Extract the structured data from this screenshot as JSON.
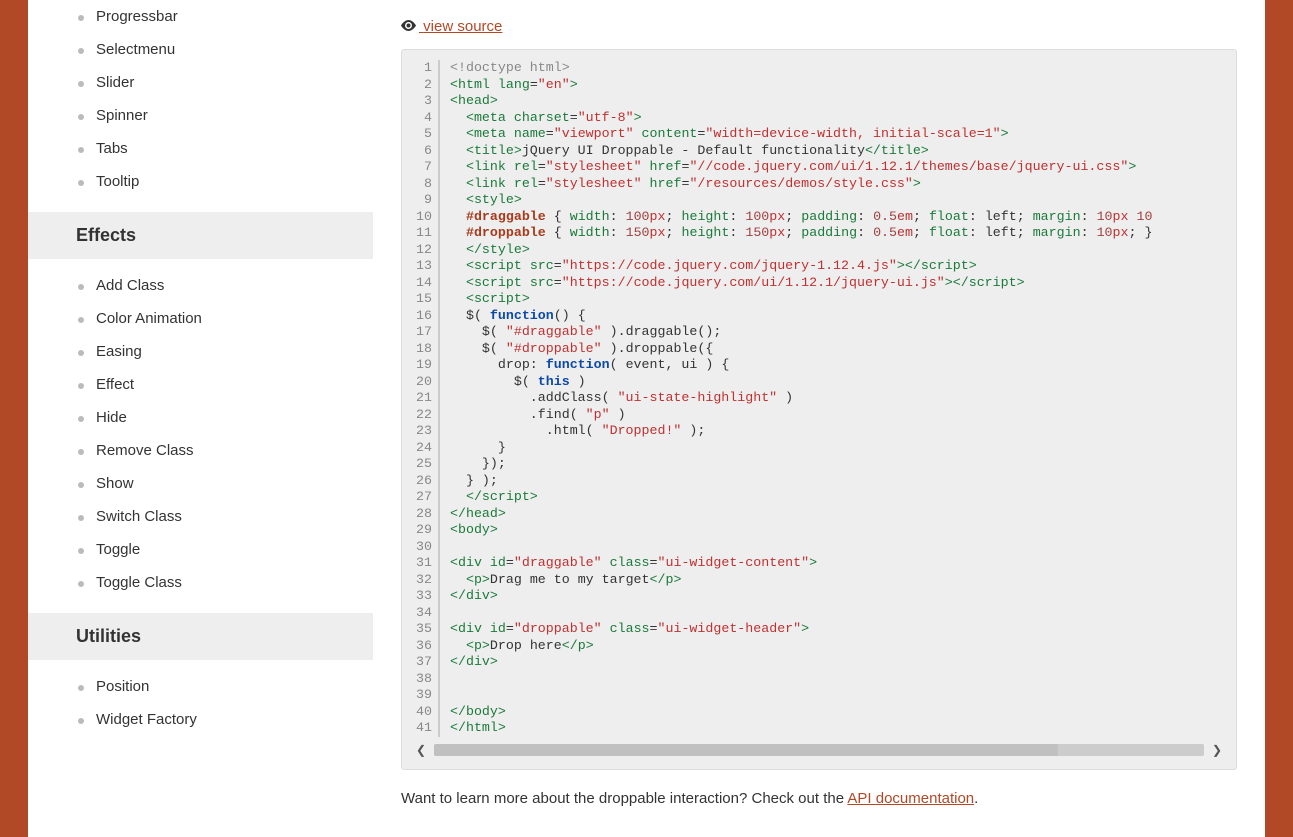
{
  "sidebar": {
    "widgets": [
      "Progressbar",
      "Selectmenu",
      "Slider",
      "Spinner",
      "Tabs",
      "Tooltip"
    ],
    "effects_title": "Effects",
    "effects": [
      "Add Class",
      "Color Animation",
      "Easing",
      "Effect",
      "Hide",
      "Remove Class",
      "Show",
      "Switch Class",
      "Toggle",
      "Toggle Class"
    ],
    "utilities_title": "Utilities",
    "utilities": [
      "Position",
      "Widget Factory"
    ]
  },
  "view_source_label": "view source",
  "code_lines": 41,
  "source": [
    {
      "n": 1,
      "tokens": [
        {
          "c": "t-pi",
          "t": "<!doctype html>"
        }
      ]
    },
    {
      "n": 2,
      "tokens": [
        {
          "c": "t-tag",
          "t": "<html"
        },
        {
          "c": "",
          "t": " "
        },
        {
          "c": "t-attr",
          "t": "lang"
        },
        {
          "c": "",
          "t": "="
        },
        {
          "c": "t-str",
          "t": "\"en\""
        },
        {
          "c": "t-tag",
          "t": ">"
        }
      ]
    },
    {
      "n": 3,
      "tokens": [
        {
          "c": "t-tag",
          "t": "<head>"
        }
      ]
    },
    {
      "n": 4,
      "tokens": [
        {
          "c": "",
          "t": "  "
        },
        {
          "c": "t-tag",
          "t": "<meta"
        },
        {
          "c": "",
          "t": " "
        },
        {
          "c": "t-attr",
          "t": "charset"
        },
        {
          "c": "",
          "t": "="
        },
        {
          "c": "t-str",
          "t": "\"utf-8\""
        },
        {
          "c": "t-tag",
          "t": ">"
        }
      ]
    },
    {
      "n": 5,
      "tokens": [
        {
          "c": "",
          "t": "  "
        },
        {
          "c": "t-tag",
          "t": "<meta"
        },
        {
          "c": "",
          "t": " "
        },
        {
          "c": "t-attr",
          "t": "name"
        },
        {
          "c": "",
          "t": "="
        },
        {
          "c": "t-str",
          "t": "\"viewport\""
        },
        {
          "c": "",
          "t": " "
        },
        {
          "c": "t-attr",
          "t": "content"
        },
        {
          "c": "",
          "t": "="
        },
        {
          "c": "t-str",
          "t": "\"width=device-width, initial-scale=1\""
        },
        {
          "c": "t-tag",
          "t": ">"
        }
      ]
    },
    {
      "n": 6,
      "tokens": [
        {
          "c": "",
          "t": "  "
        },
        {
          "c": "t-tag",
          "t": "<title>"
        },
        {
          "c": "",
          "t": "jQuery UI Droppable - Default functionality"
        },
        {
          "c": "t-tag",
          "t": "</title>"
        }
      ]
    },
    {
      "n": 7,
      "tokens": [
        {
          "c": "",
          "t": "  "
        },
        {
          "c": "t-tag",
          "t": "<link"
        },
        {
          "c": "",
          "t": " "
        },
        {
          "c": "t-attr",
          "t": "rel"
        },
        {
          "c": "",
          "t": "="
        },
        {
          "c": "t-str",
          "t": "\"stylesheet\""
        },
        {
          "c": "",
          "t": " "
        },
        {
          "c": "t-attr",
          "t": "href"
        },
        {
          "c": "",
          "t": "="
        },
        {
          "c": "t-str",
          "t": "\"//code.jquery.com/ui/1.12.1/themes/base/jquery-ui.css\""
        },
        {
          "c": "t-tag",
          "t": ">"
        }
      ]
    },
    {
      "n": 8,
      "tokens": [
        {
          "c": "",
          "t": "  "
        },
        {
          "c": "t-tag",
          "t": "<link"
        },
        {
          "c": "",
          "t": " "
        },
        {
          "c": "t-attr",
          "t": "rel"
        },
        {
          "c": "",
          "t": "="
        },
        {
          "c": "t-str",
          "t": "\"stylesheet\""
        },
        {
          "c": "",
          "t": " "
        },
        {
          "c": "t-attr",
          "t": "href"
        },
        {
          "c": "",
          "t": "="
        },
        {
          "c": "t-str",
          "t": "\"/resources/demos/style.css\""
        },
        {
          "c": "t-tag",
          "t": ">"
        }
      ]
    },
    {
      "n": 9,
      "tokens": [
        {
          "c": "",
          "t": "  "
        },
        {
          "c": "t-tag",
          "t": "<style>"
        }
      ]
    },
    {
      "n": 10,
      "tokens": [
        {
          "c": "",
          "t": "  "
        },
        {
          "c": "t-sel",
          "t": "#draggable"
        },
        {
          "c": "",
          "t": " { "
        },
        {
          "c": "t-prop",
          "t": "width"
        },
        {
          "c": "",
          "t": ": "
        },
        {
          "c": "t-num",
          "t": "100"
        },
        {
          "c": "t-unit",
          "t": "px"
        },
        {
          "c": "",
          "t": "; "
        },
        {
          "c": "t-prop",
          "t": "height"
        },
        {
          "c": "",
          "t": ": "
        },
        {
          "c": "t-num",
          "t": "100"
        },
        {
          "c": "t-unit",
          "t": "px"
        },
        {
          "c": "",
          "t": "; "
        },
        {
          "c": "t-prop",
          "t": "padding"
        },
        {
          "c": "",
          "t": ": "
        },
        {
          "c": "t-num",
          "t": "0.5"
        },
        {
          "c": "t-unit",
          "t": "em"
        },
        {
          "c": "",
          "t": "; "
        },
        {
          "c": "t-prop",
          "t": "float"
        },
        {
          "c": "",
          "t": ": left; "
        },
        {
          "c": "t-prop",
          "t": "margin"
        },
        {
          "c": "",
          "t": ": "
        },
        {
          "c": "t-num",
          "t": "10"
        },
        {
          "c": "t-unit",
          "t": "px"
        },
        {
          "c": "",
          "t": " "
        },
        {
          "c": "t-num",
          "t": "10"
        }
      ]
    },
    {
      "n": 11,
      "tokens": [
        {
          "c": "",
          "t": "  "
        },
        {
          "c": "t-sel",
          "t": "#droppable"
        },
        {
          "c": "",
          "t": " { "
        },
        {
          "c": "t-prop",
          "t": "width"
        },
        {
          "c": "",
          "t": ": "
        },
        {
          "c": "t-num",
          "t": "150"
        },
        {
          "c": "t-unit",
          "t": "px"
        },
        {
          "c": "",
          "t": "; "
        },
        {
          "c": "t-prop",
          "t": "height"
        },
        {
          "c": "",
          "t": ": "
        },
        {
          "c": "t-num",
          "t": "150"
        },
        {
          "c": "t-unit",
          "t": "px"
        },
        {
          "c": "",
          "t": "; "
        },
        {
          "c": "t-prop",
          "t": "padding"
        },
        {
          "c": "",
          "t": ": "
        },
        {
          "c": "t-num",
          "t": "0.5"
        },
        {
          "c": "t-unit",
          "t": "em"
        },
        {
          "c": "",
          "t": "; "
        },
        {
          "c": "t-prop",
          "t": "float"
        },
        {
          "c": "",
          "t": ": left; "
        },
        {
          "c": "t-prop",
          "t": "margin"
        },
        {
          "c": "",
          "t": ": "
        },
        {
          "c": "t-num",
          "t": "10"
        },
        {
          "c": "t-unit",
          "t": "px"
        },
        {
          "c": "",
          "t": "; }"
        }
      ]
    },
    {
      "n": 12,
      "tokens": [
        {
          "c": "",
          "t": "  "
        },
        {
          "c": "t-tag",
          "t": "</style>"
        }
      ]
    },
    {
      "n": 13,
      "tokens": [
        {
          "c": "",
          "t": "  "
        },
        {
          "c": "t-tag",
          "t": "<script"
        },
        {
          "c": "",
          "t": " "
        },
        {
          "c": "t-attr",
          "t": "src"
        },
        {
          "c": "",
          "t": "="
        },
        {
          "c": "t-str",
          "t": "\"https://code.jquery.com/jquery-1.12.4.js\""
        },
        {
          "c": "t-tag",
          "t": ">"
        },
        {
          "c": "t-tag",
          "t": "</script>"
        }
      ]
    },
    {
      "n": 14,
      "tokens": [
        {
          "c": "",
          "t": "  "
        },
        {
          "c": "t-tag",
          "t": "<script"
        },
        {
          "c": "",
          "t": " "
        },
        {
          "c": "t-attr",
          "t": "src"
        },
        {
          "c": "",
          "t": "="
        },
        {
          "c": "t-str",
          "t": "\"https://code.jquery.com/ui/1.12.1/jquery-ui.js\""
        },
        {
          "c": "t-tag",
          "t": ">"
        },
        {
          "c": "t-tag",
          "t": "</script>"
        }
      ]
    },
    {
      "n": 15,
      "tokens": [
        {
          "c": "",
          "t": "  "
        },
        {
          "c": "t-tag",
          "t": "<script>"
        }
      ]
    },
    {
      "n": 16,
      "tokens": [
        {
          "c": "",
          "t": "  $( "
        },
        {
          "c": "t-fn",
          "t": "function"
        },
        {
          "c": "",
          "t": "() {"
        }
      ]
    },
    {
      "n": 17,
      "tokens": [
        {
          "c": "",
          "t": "    $( "
        },
        {
          "c": "t-str",
          "t": "\"#draggable\""
        },
        {
          "c": "",
          "t": " ).draggable();"
        }
      ]
    },
    {
      "n": 18,
      "tokens": [
        {
          "c": "",
          "t": "    $( "
        },
        {
          "c": "t-str",
          "t": "\"#droppable\""
        },
        {
          "c": "",
          "t": " ).droppable({"
        }
      ]
    },
    {
      "n": 19,
      "tokens": [
        {
          "c": "",
          "t": "      drop: "
        },
        {
          "c": "t-fn",
          "t": "function"
        },
        {
          "c": "",
          "t": "( event, ui ) {"
        }
      ]
    },
    {
      "n": 20,
      "tokens": [
        {
          "c": "",
          "t": "        $( "
        },
        {
          "c": "t-kw",
          "t": "this"
        },
        {
          "c": "",
          "t": " )"
        }
      ]
    },
    {
      "n": 21,
      "tokens": [
        {
          "c": "",
          "t": "          .addClass( "
        },
        {
          "c": "t-str",
          "t": "\"ui-state-highlight\""
        },
        {
          "c": "",
          "t": " )"
        }
      ]
    },
    {
      "n": 22,
      "tokens": [
        {
          "c": "",
          "t": "          .find( "
        },
        {
          "c": "t-str",
          "t": "\"p\""
        },
        {
          "c": "",
          "t": " )"
        }
      ]
    },
    {
      "n": 23,
      "tokens": [
        {
          "c": "",
          "t": "            .html( "
        },
        {
          "c": "t-str",
          "t": "\"Dropped!\""
        },
        {
          "c": "",
          "t": " );"
        }
      ]
    },
    {
      "n": 24,
      "tokens": [
        {
          "c": "",
          "t": "      }"
        }
      ]
    },
    {
      "n": 25,
      "tokens": [
        {
          "c": "",
          "t": "    });"
        }
      ]
    },
    {
      "n": 26,
      "tokens": [
        {
          "c": "",
          "t": "  } );"
        }
      ]
    },
    {
      "n": 27,
      "tokens": [
        {
          "c": "",
          "t": "  "
        },
        {
          "c": "t-tag",
          "t": "</script>"
        }
      ]
    },
    {
      "n": 28,
      "tokens": [
        {
          "c": "t-tag",
          "t": "</head>"
        }
      ]
    },
    {
      "n": 29,
      "tokens": [
        {
          "c": "t-tag",
          "t": "<body>"
        }
      ]
    },
    {
      "n": 30,
      "tokens": [
        {
          "c": "",
          "t": " "
        }
      ]
    },
    {
      "n": 31,
      "tokens": [
        {
          "c": "t-tag",
          "t": "<div"
        },
        {
          "c": "",
          "t": " "
        },
        {
          "c": "t-attr",
          "t": "id"
        },
        {
          "c": "",
          "t": "="
        },
        {
          "c": "t-str",
          "t": "\"draggable\""
        },
        {
          "c": "",
          "t": " "
        },
        {
          "c": "t-attr",
          "t": "class"
        },
        {
          "c": "",
          "t": "="
        },
        {
          "c": "t-str",
          "t": "\"ui-widget-content\""
        },
        {
          "c": "t-tag",
          "t": ">"
        }
      ]
    },
    {
      "n": 32,
      "tokens": [
        {
          "c": "",
          "t": "  "
        },
        {
          "c": "t-tag",
          "t": "<p>"
        },
        {
          "c": "",
          "t": "Drag me to my target"
        },
        {
          "c": "t-tag",
          "t": "</p>"
        }
      ]
    },
    {
      "n": 33,
      "tokens": [
        {
          "c": "t-tag",
          "t": "</div>"
        }
      ]
    },
    {
      "n": 34,
      "tokens": [
        {
          "c": "",
          "t": " "
        }
      ]
    },
    {
      "n": 35,
      "tokens": [
        {
          "c": "t-tag",
          "t": "<div"
        },
        {
          "c": "",
          "t": " "
        },
        {
          "c": "t-attr",
          "t": "id"
        },
        {
          "c": "",
          "t": "="
        },
        {
          "c": "t-str",
          "t": "\"droppable\""
        },
        {
          "c": "",
          "t": " "
        },
        {
          "c": "t-attr",
          "t": "class"
        },
        {
          "c": "",
          "t": "="
        },
        {
          "c": "t-str",
          "t": "\"ui-widget-header\""
        },
        {
          "c": "t-tag",
          "t": ">"
        }
      ]
    },
    {
      "n": 36,
      "tokens": [
        {
          "c": "",
          "t": "  "
        },
        {
          "c": "t-tag",
          "t": "<p>"
        },
        {
          "c": "",
          "t": "Drop here"
        },
        {
          "c": "t-tag",
          "t": "</p>"
        }
      ]
    },
    {
      "n": 37,
      "tokens": [
        {
          "c": "t-tag",
          "t": "</div>"
        }
      ]
    },
    {
      "n": 38,
      "tokens": [
        {
          "c": "",
          "t": " "
        }
      ]
    },
    {
      "n": 39,
      "tokens": [
        {
          "c": "",
          "t": " "
        }
      ]
    },
    {
      "n": 40,
      "tokens": [
        {
          "c": "t-tag",
          "t": "</body>"
        }
      ]
    },
    {
      "n": 41,
      "tokens": [
        {
          "c": "t-tag",
          "t": "</html>"
        }
      ]
    }
  ],
  "footer": {
    "prefix": "Want to learn more about the droppable interaction? Check out the ",
    "link": "API documentation",
    "suffix": "."
  }
}
